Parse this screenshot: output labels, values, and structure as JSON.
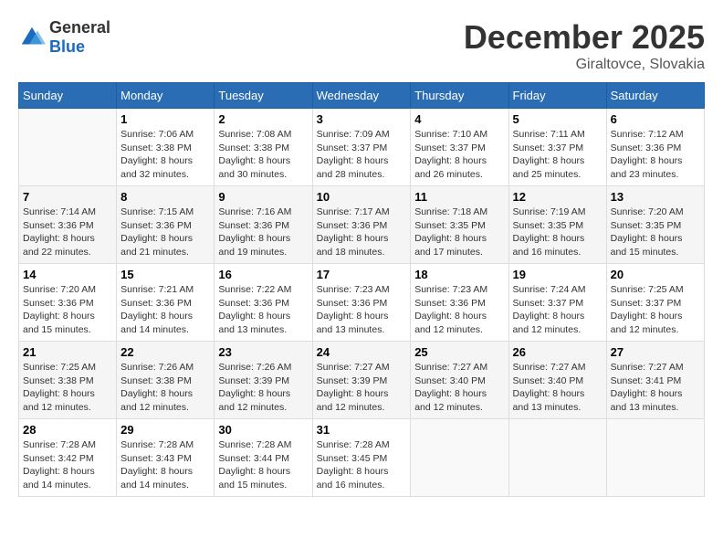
{
  "logo": {
    "general": "General",
    "blue": "Blue"
  },
  "title": "December 2025",
  "location": "Giraltovce, Slovakia",
  "days_of_week": [
    "Sunday",
    "Monday",
    "Tuesday",
    "Wednesday",
    "Thursday",
    "Friday",
    "Saturday"
  ],
  "weeks": [
    [
      {
        "day": "",
        "sunrise": "",
        "sunset": "",
        "daylight": ""
      },
      {
        "day": "1",
        "sunrise": "Sunrise: 7:06 AM",
        "sunset": "Sunset: 3:38 PM",
        "daylight": "Daylight: 8 hours and 32 minutes."
      },
      {
        "day": "2",
        "sunrise": "Sunrise: 7:08 AM",
        "sunset": "Sunset: 3:38 PM",
        "daylight": "Daylight: 8 hours and 30 minutes."
      },
      {
        "day": "3",
        "sunrise": "Sunrise: 7:09 AM",
        "sunset": "Sunset: 3:37 PM",
        "daylight": "Daylight: 8 hours and 28 minutes."
      },
      {
        "day": "4",
        "sunrise": "Sunrise: 7:10 AM",
        "sunset": "Sunset: 3:37 PM",
        "daylight": "Daylight: 8 hours and 26 minutes."
      },
      {
        "day": "5",
        "sunrise": "Sunrise: 7:11 AM",
        "sunset": "Sunset: 3:37 PM",
        "daylight": "Daylight: 8 hours and 25 minutes."
      },
      {
        "day": "6",
        "sunrise": "Sunrise: 7:12 AM",
        "sunset": "Sunset: 3:36 PM",
        "daylight": "Daylight: 8 hours and 23 minutes."
      }
    ],
    [
      {
        "day": "7",
        "sunrise": "Sunrise: 7:14 AM",
        "sunset": "Sunset: 3:36 PM",
        "daylight": "Daylight: 8 hours and 22 minutes."
      },
      {
        "day": "8",
        "sunrise": "Sunrise: 7:15 AM",
        "sunset": "Sunset: 3:36 PM",
        "daylight": "Daylight: 8 hours and 21 minutes."
      },
      {
        "day": "9",
        "sunrise": "Sunrise: 7:16 AM",
        "sunset": "Sunset: 3:36 PM",
        "daylight": "Daylight: 8 hours and 19 minutes."
      },
      {
        "day": "10",
        "sunrise": "Sunrise: 7:17 AM",
        "sunset": "Sunset: 3:36 PM",
        "daylight": "Daylight: 8 hours and 18 minutes."
      },
      {
        "day": "11",
        "sunrise": "Sunrise: 7:18 AM",
        "sunset": "Sunset: 3:35 PM",
        "daylight": "Daylight: 8 hours and 17 minutes."
      },
      {
        "day": "12",
        "sunrise": "Sunrise: 7:19 AM",
        "sunset": "Sunset: 3:35 PM",
        "daylight": "Daylight: 8 hours and 16 minutes."
      },
      {
        "day": "13",
        "sunrise": "Sunrise: 7:20 AM",
        "sunset": "Sunset: 3:35 PM",
        "daylight": "Daylight: 8 hours and 15 minutes."
      }
    ],
    [
      {
        "day": "14",
        "sunrise": "Sunrise: 7:20 AM",
        "sunset": "Sunset: 3:36 PM",
        "daylight": "Daylight: 8 hours and 15 minutes."
      },
      {
        "day": "15",
        "sunrise": "Sunrise: 7:21 AM",
        "sunset": "Sunset: 3:36 PM",
        "daylight": "Daylight: 8 hours and 14 minutes."
      },
      {
        "day": "16",
        "sunrise": "Sunrise: 7:22 AM",
        "sunset": "Sunset: 3:36 PM",
        "daylight": "Daylight: 8 hours and 13 minutes."
      },
      {
        "day": "17",
        "sunrise": "Sunrise: 7:23 AM",
        "sunset": "Sunset: 3:36 PM",
        "daylight": "Daylight: 8 hours and 13 minutes."
      },
      {
        "day": "18",
        "sunrise": "Sunrise: 7:23 AM",
        "sunset": "Sunset: 3:36 PM",
        "daylight": "Daylight: 8 hours and 12 minutes."
      },
      {
        "day": "19",
        "sunrise": "Sunrise: 7:24 AM",
        "sunset": "Sunset: 3:37 PM",
        "daylight": "Daylight: 8 hours and 12 minutes."
      },
      {
        "day": "20",
        "sunrise": "Sunrise: 7:25 AM",
        "sunset": "Sunset: 3:37 PM",
        "daylight": "Daylight: 8 hours and 12 minutes."
      }
    ],
    [
      {
        "day": "21",
        "sunrise": "Sunrise: 7:25 AM",
        "sunset": "Sunset: 3:38 PM",
        "daylight": "Daylight: 8 hours and 12 minutes."
      },
      {
        "day": "22",
        "sunrise": "Sunrise: 7:26 AM",
        "sunset": "Sunset: 3:38 PM",
        "daylight": "Daylight: 8 hours and 12 minutes."
      },
      {
        "day": "23",
        "sunrise": "Sunrise: 7:26 AM",
        "sunset": "Sunset: 3:39 PM",
        "daylight": "Daylight: 8 hours and 12 minutes."
      },
      {
        "day": "24",
        "sunrise": "Sunrise: 7:27 AM",
        "sunset": "Sunset: 3:39 PM",
        "daylight": "Daylight: 8 hours and 12 minutes."
      },
      {
        "day": "25",
        "sunrise": "Sunrise: 7:27 AM",
        "sunset": "Sunset: 3:40 PM",
        "daylight": "Daylight: 8 hours and 12 minutes."
      },
      {
        "day": "26",
        "sunrise": "Sunrise: 7:27 AM",
        "sunset": "Sunset: 3:40 PM",
        "daylight": "Daylight: 8 hours and 13 minutes."
      },
      {
        "day": "27",
        "sunrise": "Sunrise: 7:27 AM",
        "sunset": "Sunset: 3:41 PM",
        "daylight": "Daylight: 8 hours and 13 minutes."
      }
    ],
    [
      {
        "day": "28",
        "sunrise": "Sunrise: 7:28 AM",
        "sunset": "Sunset: 3:42 PM",
        "daylight": "Daylight: 8 hours and 14 minutes."
      },
      {
        "day": "29",
        "sunrise": "Sunrise: 7:28 AM",
        "sunset": "Sunset: 3:43 PM",
        "daylight": "Daylight: 8 hours and 14 minutes."
      },
      {
        "day": "30",
        "sunrise": "Sunrise: 7:28 AM",
        "sunset": "Sunset: 3:44 PM",
        "daylight": "Daylight: 8 hours and 15 minutes."
      },
      {
        "day": "31",
        "sunrise": "Sunrise: 7:28 AM",
        "sunset": "Sunset: 3:45 PM",
        "daylight": "Daylight: 8 hours and 16 minutes."
      },
      {
        "day": "",
        "sunrise": "",
        "sunset": "",
        "daylight": ""
      },
      {
        "day": "",
        "sunrise": "",
        "sunset": "",
        "daylight": ""
      },
      {
        "day": "",
        "sunrise": "",
        "sunset": "",
        "daylight": ""
      }
    ]
  ]
}
